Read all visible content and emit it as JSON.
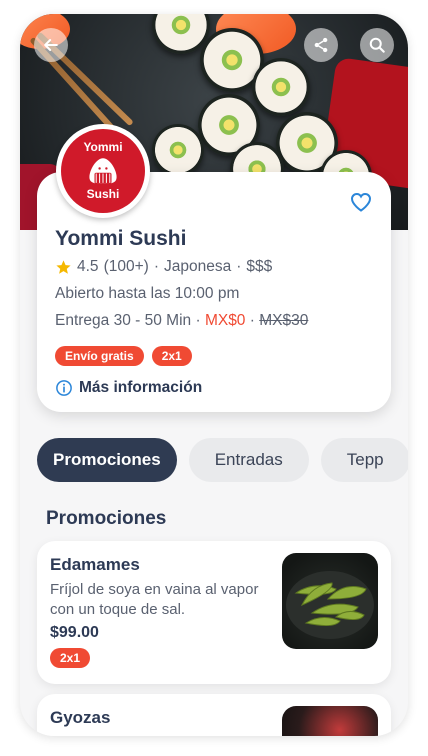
{
  "header": {
    "back_icon": "arrow-left-icon",
    "share_icon": "share-icon",
    "search_icon": "search-icon"
  },
  "restaurant": {
    "logo_top": "Yommi",
    "logo_bottom": "Sushi",
    "name": "Yommi Sushi",
    "rating": "4.5",
    "reviews": "(100+)",
    "sep": "·",
    "cuisine": "Japonesa",
    "price_level": "$$$",
    "hours": "Abierto hasta las 10:00 pm",
    "delivery_label": "Entrega 30 - 50 Min",
    "delivery_fee": "MX$0",
    "delivery_fee_old": "MX$30",
    "badges": [
      "Envío gratis",
      "2x1"
    ],
    "more_info": "Más información"
  },
  "tabs": [
    {
      "label": "Promociones"
    },
    {
      "label": "Entradas"
    },
    {
      "label": "Tepp"
    }
  ],
  "section": {
    "title": "Promociones"
  },
  "products": [
    {
      "name": "Edamames",
      "description": "Fríjol de soya en vaina al vapor con un toque de sal.",
      "price": "$99.00",
      "badge": "2x1"
    },
    {
      "name": "Gyozas"
    }
  ],
  "colors": {
    "accent": "#f04a33",
    "dark": "#2f3b52",
    "star": "#f5b800",
    "link_blue": "#2b86d9"
  }
}
